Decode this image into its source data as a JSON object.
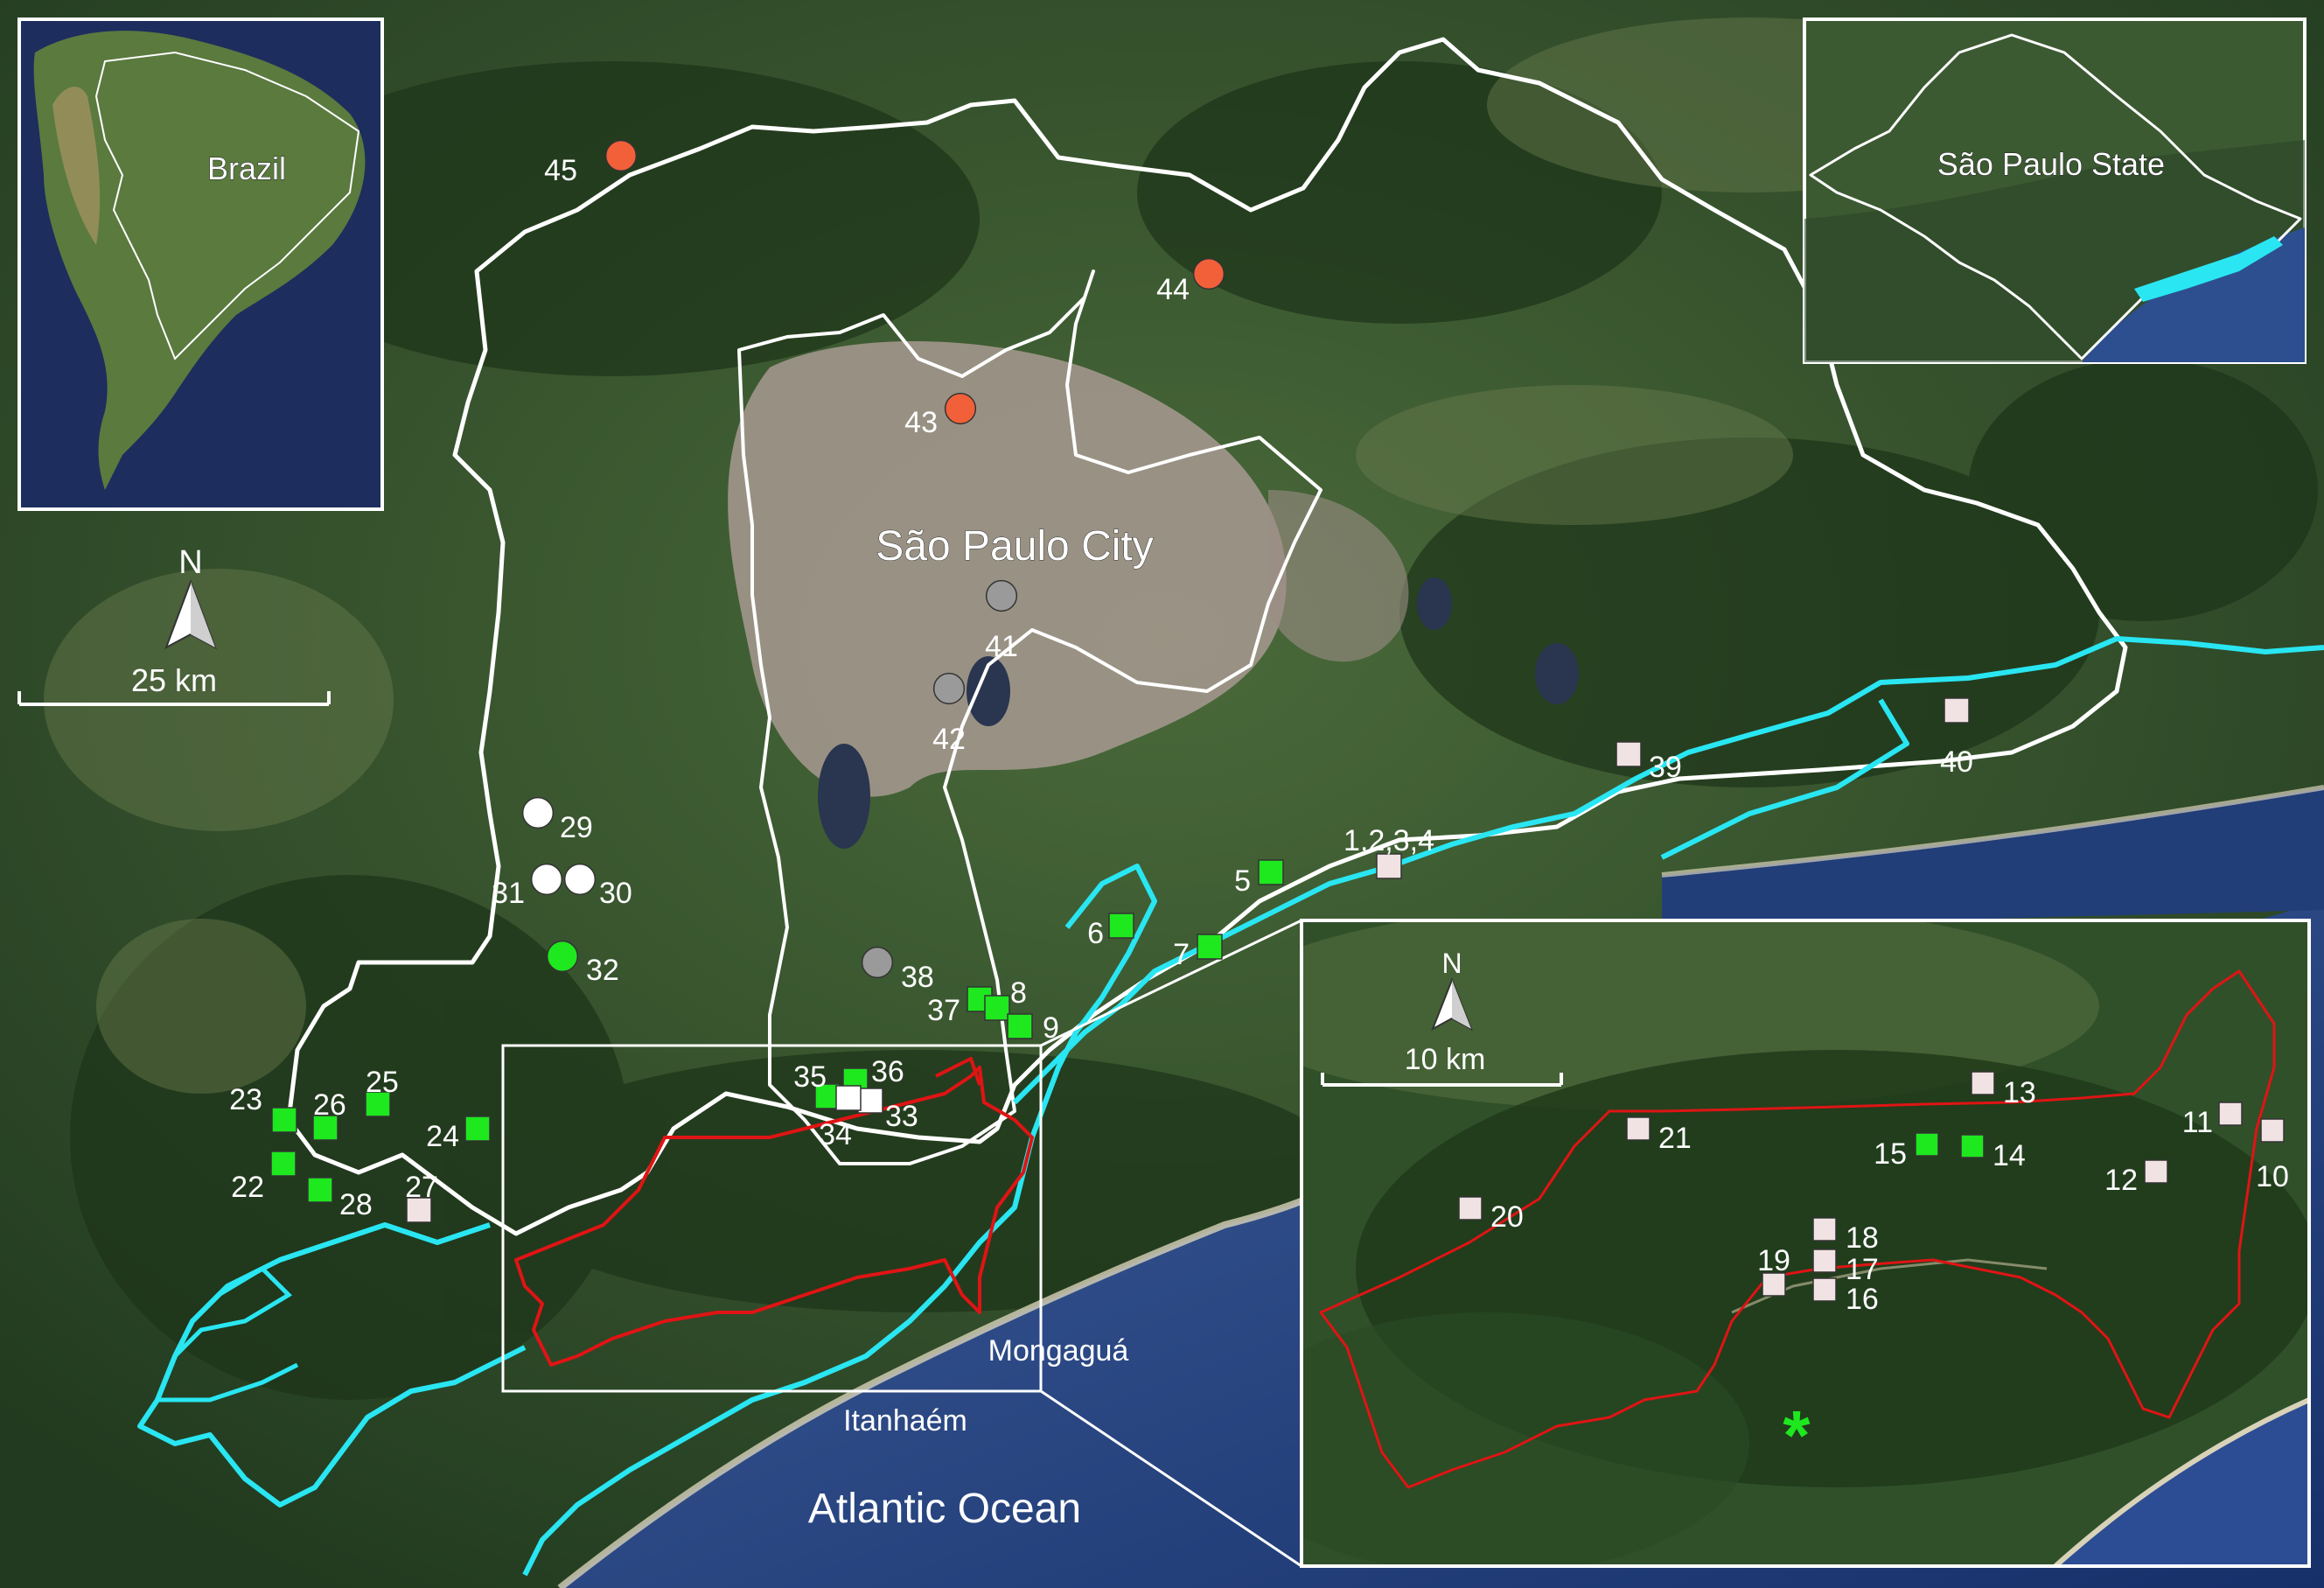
{
  "place_labels": {
    "city": "São Paulo City",
    "ocean": "Atlantic Ocean",
    "town_1": "Mongaguá",
    "town_2": "Itanhaém"
  },
  "inset_brazil": {
    "label": "Brazil"
  },
  "inset_state": {
    "label": "São Paulo State"
  },
  "main_scale": {
    "north": "N",
    "distance": "25 km"
  },
  "detail_scale": {
    "north": "N",
    "distance": "10 km"
  },
  "colors": {
    "white_boundary": "#ffffff",
    "cyan_boundary": "#29e6f2",
    "red_boundary": "#e01414",
    "green_marker": "#1ee81e",
    "orange_marker": "#f2603a",
    "gray_marker": "#9a9a9a",
    "light_marker": "#f1e3e3"
  },
  "main_sites": [
    {
      "label": "45",
      "shape": "circle",
      "color": "orange"
    },
    {
      "label": "44",
      "shape": "circle",
      "color": "orange"
    },
    {
      "label": "43",
      "shape": "circle",
      "color": "orange"
    },
    {
      "label": "41",
      "shape": "circle",
      "color": "gray"
    },
    {
      "label": "42",
      "shape": "circle",
      "color": "gray"
    },
    {
      "label": "38",
      "shape": "circle",
      "color": "gray"
    },
    {
      "label": "29",
      "shape": "circle",
      "color": "white"
    },
    {
      "label": "31",
      "shape": "circle",
      "color": "white"
    },
    {
      "label": "30",
      "shape": "circle",
      "color": "white"
    },
    {
      "label": "32",
      "shape": "circle",
      "color": "green"
    },
    {
      "label": "5",
      "shape": "square",
      "color": "green"
    },
    {
      "label": "6",
      "shape": "square",
      "color": "green"
    },
    {
      "label": "7",
      "shape": "square",
      "color": "green"
    },
    {
      "label": "37",
      "shape": "square",
      "color": "green"
    },
    {
      "label": "8",
      "shape": "square",
      "color": "green"
    },
    {
      "label": "9",
      "shape": "square",
      "color": "green"
    },
    {
      "label": "35",
      "shape": "square",
      "color": "green"
    },
    {
      "label": "36",
      "shape": "square",
      "color": "green"
    },
    {
      "label": "33",
      "shape": "square",
      "color": "white"
    },
    {
      "label": "34",
      "shape": "square",
      "color": "white"
    },
    {
      "label": "1,2,3,4",
      "shape": "square",
      "color": "light"
    },
    {
      "label": "39",
      "shape": "square",
      "color": "light"
    },
    {
      "label": "40",
      "shape": "square",
      "color": "light"
    },
    {
      "label": "23",
      "shape": "square",
      "color": "green"
    },
    {
      "label": "26",
      "shape": "square",
      "color": "green"
    },
    {
      "label": "25",
      "shape": "square",
      "color": "green"
    },
    {
      "label": "24",
      "shape": "square",
      "color": "green"
    },
    {
      "label": "22",
      "shape": "square",
      "color": "green"
    },
    {
      "label": "28",
      "shape": "square",
      "color": "green"
    },
    {
      "label": "27",
      "shape": "square",
      "color": "light"
    }
  ],
  "detail_sites": [
    {
      "label": "13",
      "shape": "square",
      "color": "light"
    },
    {
      "label": "21",
      "shape": "square",
      "color": "light"
    },
    {
      "label": "15",
      "shape": "square",
      "color": "green"
    },
    {
      "label": "14",
      "shape": "square",
      "color": "green"
    },
    {
      "label": "11",
      "shape": "square",
      "color": "light"
    },
    {
      "label": "10",
      "shape": "square",
      "color": "light"
    },
    {
      "label": "12",
      "shape": "square",
      "color": "light"
    },
    {
      "label": "20",
      "shape": "square",
      "color": "light"
    },
    {
      "label": "18",
      "shape": "square",
      "color": "light"
    },
    {
      "label": "19",
      "shape": "square",
      "color": "light"
    },
    {
      "label": "17",
      "shape": "square",
      "color": "light"
    },
    {
      "label": "16",
      "shape": "square",
      "color": "light"
    },
    {
      "label": "*",
      "shape": "asterisk",
      "color": "green"
    }
  ]
}
